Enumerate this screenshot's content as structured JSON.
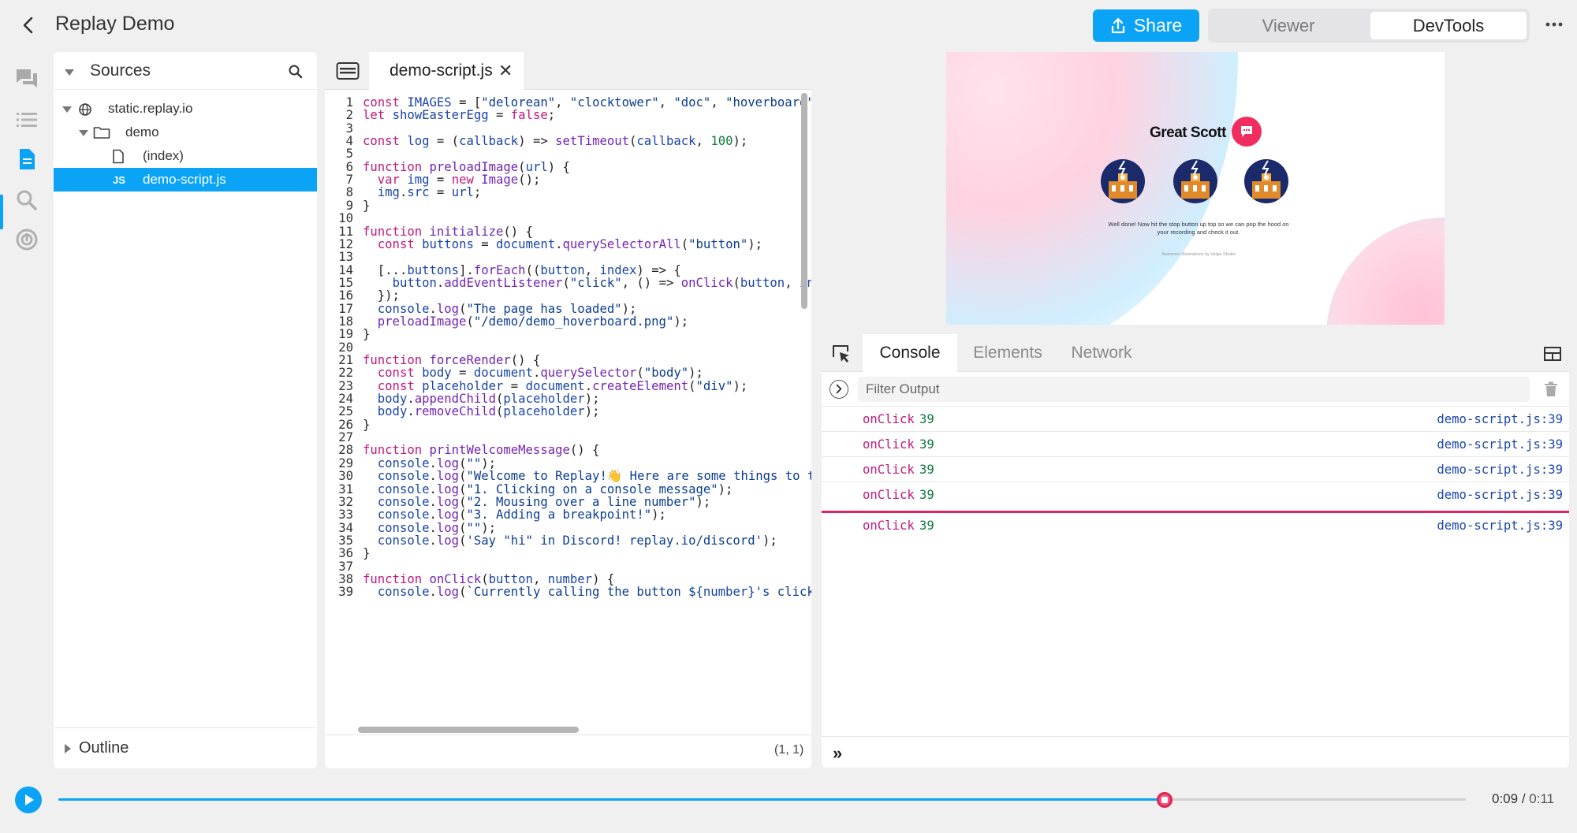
{
  "header": {
    "title": "Replay Demo",
    "share_label": "Share",
    "mode_viewer": "Viewer",
    "mode_devtools": "DevTools"
  },
  "colors": {
    "accent": "#0aa3f5",
    "highlight": "#e0245e",
    "keyword": "#c0177e",
    "string": "#0b3d91",
    "number": "#0b7a3a"
  },
  "nav": [
    "comments-icon",
    "events-icon",
    "source-icon",
    "search-icon",
    "protocol-icon"
  ],
  "sources": {
    "title": "Sources",
    "tree": [
      {
        "label": "static.replay.io",
        "icon": "globe-icon"
      },
      {
        "label": "demo",
        "icon": "folder-icon"
      },
      {
        "label": "(index)",
        "icon": "file-icon"
      },
      {
        "label": "demo-script.js",
        "icon": "js-icon",
        "badge": "JS",
        "selected": true
      }
    ],
    "outline_title": "Outline"
  },
  "editor": {
    "tab_label": "demo-script.js",
    "close_glyph": "✕",
    "cursor_position": "(1, 1)",
    "lines": [
      {
        "n": "1",
        "html": "<span class='k'>const</span> <span class='v'>IMAGES</span> = [<span class='s'>\"delorean\"</span>, <span class='s'>\"clocktower\"</span>, <span class='s'>\"doc\"</span>, <span class='s'>\"hoverboard\"</span>]"
      },
      {
        "n": "2",
        "html": "<span class='k'>let</span> <span class='v'>showEasterEgg</span> = <span class='k'>false</span>;"
      },
      {
        "n": "3",
        "html": ""
      },
      {
        "n": "4",
        "html": "<span class='k'>const</span> <span class='v'>log</span> = (<span class='v'>callback</span>) =&gt; <span class='f'>setTimeout</span>(<span class='v'>callback</span>, <span class='n'>100</span>);"
      },
      {
        "n": "5",
        "html": ""
      },
      {
        "n": "6",
        "html": "<span class='k'>function</span> <span class='f'>preloadImage</span>(<span class='v'>url</span>) {"
      },
      {
        "n": "7",
        "html": "  <span class='k'>var</span> <span class='v'>img</span> = <span class='k'>new</span> <span class='f'>Image</span>();"
      },
      {
        "n": "8",
        "html": "  <span class='v'>img</span>.<span class='v'>src</span> = <span class='v'>url</span>;"
      },
      {
        "n": "9",
        "html": "}"
      },
      {
        "n": "10",
        "html": ""
      },
      {
        "n": "11",
        "html": "<span class='k'>function</span> <span class='f'>initialize</span>() {"
      },
      {
        "n": "12",
        "html": "  <span class='k'>const</span> <span class='v'>buttons</span> = <span class='v'>document</span>.<span class='f'>querySelectorAll</span>(<span class='s'>\"button\"</span>);"
      },
      {
        "n": "13",
        "html": ""
      },
      {
        "n": "14",
        "html": "  [...<span class='v'>buttons</span>].<span class='f'>forEach</span>((<span class='v'>button</span>, <span class='v'>index</span>) =&gt; {"
      },
      {
        "n": "15",
        "html": "    <span class='v'>button</span>.<span class='f'>addEventListener</span>(<span class='s'>\"click\"</span>, () =&gt; <span class='f'>onClick</span>(<span class='v'>button</span>, <span class='v'>index</span>"
      },
      {
        "n": "16",
        "html": "  });"
      },
      {
        "n": "17",
        "html": "  <span class='v'>console</span>.<span class='f'>log</span>(<span class='s'>\"The page has loaded\"</span>);"
      },
      {
        "n": "18",
        "html": "  <span class='f'>preloadImage</span>(<span class='s'>\"/demo/demo_hoverboard.png\"</span>);"
      },
      {
        "n": "19",
        "html": "}"
      },
      {
        "n": "20",
        "html": ""
      },
      {
        "n": "21",
        "html": "<span class='k'>function</span> <span class='f'>forceRender</span>() {"
      },
      {
        "n": "22",
        "html": "  <span class='k'>const</span> <span class='v'>body</span> = <span class='v'>document</span>.<span class='f'>querySelector</span>(<span class='s'>\"body\"</span>);"
      },
      {
        "n": "23",
        "html": "  <span class='k'>const</span> <span class='v'>placeholder</span> = <span class='v'>document</span>.<span class='f'>createElement</span>(<span class='s'>\"div\"</span>);"
      },
      {
        "n": "24",
        "html": "  <span class='v'>body</span>.<span class='f'>appendChild</span>(<span class='v'>placeholder</span>);"
      },
      {
        "n": "25",
        "html": "  <span class='v'>body</span>.<span class='f'>removeChild</span>(<span class='v'>placeholder</span>);"
      },
      {
        "n": "26",
        "html": "}"
      },
      {
        "n": "27",
        "html": ""
      },
      {
        "n": "28",
        "html": "<span class='k'>function</span> <span class='f'>printWelcomeMessage</span>() {"
      },
      {
        "n": "29",
        "html": "  <span class='v'>console</span>.<span class='f'>log</span>(<span class='s'>\"\"</span>);"
      },
      {
        "n": "30",
        "html": "  <span class='v'>console</span>.<span class='f'>log</span>(<span class='s'>\"Welcome to Replay!👋 Here are some things to try\"</span>"
      },
      {
        "n": "31",
        "html": "  <span class='v'>console</span>.<span class='f'>log</span>(<span class='s'>\"1. Clicking on a console message\"</span>);"
      },
      {
        "n": "32",
        "html": "  <span class='v'>console</span>.<span class='f'>log</span>(<span class='s'>\"2. Mousing over a line number\"</span>);"
      },
      {
        "n": "33",
        "html": "  <span class='v'>console</span>.<span class='f'>log</span>(<span class='s'>\"3. Adding a breakpoint!\"</span>);"
      },
      {
        "n": "34",
        "html": "  <span class='v'>console</span>.<span class='f'>log</span>(<span class='s'>\"\"</span>);"
      },
      {
        "n": "35",
        "html": "  <span class='v'>console</span>.<span class='f'>log</span>(<span class='s'>'Say \"hi\" in Discord! replay.io/discord'</span>);"
      },
      {
        "n": "36",
        "html": "}"
      },
      {
        "n": "37",
        "html": ""
      },
      {
        "n": "38",
        "html": "<span class='k'>function</span> <span class='f'>onClick</span>(<span class='v'>button</span>, <span class='v'>number</span>) {"
      },
      {
        "n": "39",
        "html": "  <span class='v'>console</span>.<span class='f'>log</span>(<span class='s'>`Currently calling the button ${</span><span class='v'>number</span><span class='s'>}'s click</span>"
      }
    ]
  },
  "preview": {
    "heading": "Great Scott",
    "message": "Well done! Now hit the stop button up top so we can pop the hood on your recording and check it out.",
    "credit": "Awesome illustrations by Varga Studio"
  },
  "console": {
    "tabs": [
      "Console",
      "Elements",
      "Network"
    ],
    "active_tab": "Console",
    "filter_placeholder": "Filter Output",
    "messages": [
      {
        "fn": "onClick",
        "value": "39",
        "location": "demo-script.js:39"
      },
      {
        "fn": "onClick",
        "value": "39",
        "location": "demo-script.js:39"
      },
      {
        "fn": "onClick",
        "value": "39",
        "location": "demo-script.js:39"
      },
      {
        "fn": "onClick",
        "value": "39",
        "location": "demo-script.js:39"
      },
      {
        "fn": "onClick",
        "value": "39",
        "location": "demo-script.js:39"
      }
    ],
    "prompt_glyph": "»"
  },
  "timeline": {
    "current": "0:09",
    "separator": "/",
    "total": "0:11",
    "progress": 0.786
  }
}
